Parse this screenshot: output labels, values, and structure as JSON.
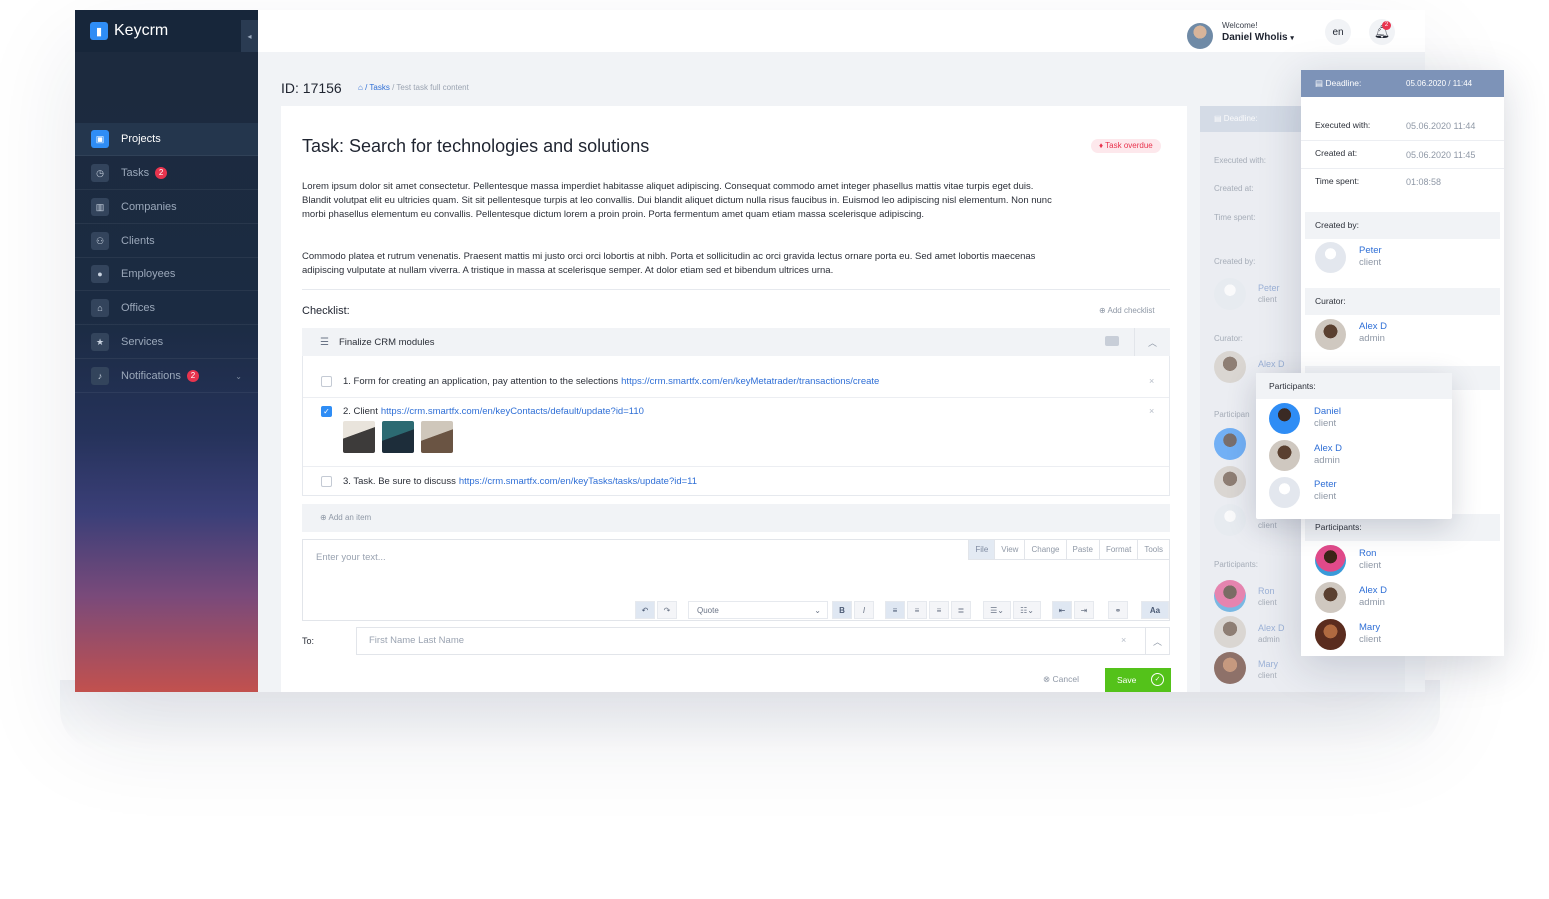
{
  "app": {
    "name": "Keycrm"
  },
  "header": {
    "welcome": "Welcome!",
    "username": "Daniel Wholis",
    "lang": "en",
    "notification_count": "2"
  },
  "sidebar": {
    "items": [
      {
        "label": "Projects",
        "icon": "briefcase-icon",
        "active": true
      },
      {
        "label": "Tasks",
        "icon": "clock-icon",
        "badge": "2"
      },
      {
        "label": "Companies",
        "icon": "building-icon"
      },
      {
        "label": "Clients",
        "icon": "users-icon"
      },
      {
        "label": "Employees",
        "icon": "user-icon"
      },
      {
        "label": "Offices",
        "icon": "bank-icon"
      },
      {
        "label": "Services",
        "icon": "star-icon"
      },
      {
        "label": "Notifications",
        "icon": "bell-icon",
        "badge": "2"
      }
    ]
  },
  "page": {
    "id_label": "ID: 17156",
    "breadcrumb": {
      "tasks": "/ Tasks",
      "sep": "/",
      "current": "Test task full content"
    }
  },
  "task": {
    "title": "Task: Search for technologies and solutions",
    "status": "Task overdue",
    "paragraph1": "Lorem ipsum dolor sit amet consectetur. Pellentesque massa imperdiet habitasse aliquet adipiscing. Consequat commodo amet integer phasellus mattis vitae turpis eget duis. Blandit volutpat elit eu ultricies quam. Sit sit pellentesque turpis at leo convallis. Dui blandit aliquet dictum nulla risus faucibus in. Euismod leo adipiscing nisl elementum. Non nunc morbi phasellus elementum eu convallis. Pellentesque dictum lorem a proin proin. Porta fermentum amet quam etiam massa scelerisque adipiscing.",
    "paragraph2": "Commodo platea et rutrum venenatis. Praesent mattis mi justo orci orci lobortis at nibh. Porta et sollicitudin ac orci gravida lectus ornare porta eu. Sed amet lobortis maecenas adipiscing vulputate at nullam viverra. A tristique in massa at scelerisque semper. At dolor etiam sed et bibendum ultrices urna."
  },
  "checklist": {
    "heading": "Checklist:",
    "add_label": "Add checklist",
    "group_title": "Finalize CRM modules",
    "items": [
      {
        "text": "1. Form for creating an application, pay attention to the selections",
        "link": "https://crm.smartfx.com/en/keyMetatrader/transactions/create",
        "checked": false
      },
      {
        "text": "2. Client",
        "link": "https://crm.smartfx.com/en/keyContacts/default/update?id=110",
        "checked": true
      },
      {
        "text": "3. Task. Be sure to discuss",
        "link": "https://crm.smartfx.com/en/keyTasks/tasks/update?id=11",
        "checked": false
      }
    ],
    "add_item_label": "Add an item"
  },
  "editor": {
    "placeholder": "Enter your text...",
    "tabs": [
      "File",
      "View",
      "Change",
      "Paste",
      "Format",
      "Tools"
    ],
    "block_format": "Quote"
  },
  "recipient": {
    "label": "To:",
    "placeholder": "First Name Last Name"
  },
  "actions": {
    "cancel": "Cancel",
    "save": "Save"
  },
  "side_panel": {
    "deadline_label": "Deadline:",
    "executed_label": "Executed with:",
    "created_label": "Created at:",
    "time_label": "Time spent:",
    "created_by_label": "Created by:",
    "creator": {
      "name": "Peter",
      "role": "client"
    },
    "curator_label": "Curator:",
    "curator": {
      "name": "Alex D"
    },
    "participants_label": "Participan",
    "participants2_label": "Participants:",
    "participants": [
      {
        "name": "Ron",
        "role": "client"
      },
      {
        "name": "Alex D",
        "role": "admin"
      },
      {
        "name": "Mary",
        "role": "client"
      }
    ],
    "hidden_role": "client"
  },
  "deadline_popup": {
    "deadline_label": "Deadline:",
    "deadline_value": "05.06.2020  /  11:44",
    "executed_label": "Executed with:",
    "executed_value": "05.06.2020 11:44",
    "created_label": "Created at:",
    "created_value": "05.06.2020 11:45",
    "time_label": "Time spent:",
    "time_value": "01:08:58",
    "created_by_label": "Created by:",
    "creator": {
      "name": "Peter",
      "role": "client"
    },
    "curator_label": "Curator:",
    "curator": {
      "name": "Alex D",
      "role": "admin"
    },
    "participants_label": "Participants:",
    "participants": [
      {
        "name": "Ron",
        "role": "client"
      },
      {
        "name": "Alex D",
        "role": "admin"
      },
      {
        "name": "Mary",
        "role": "client"
      }
    ]
  },
  "participants_dropdown": {
    "label": "Participants:",
    "people": [
      {
        "name": "Daniel",
        "role": "client"
      },
      {
        "name": "Alex D",
        "role": "admin"
      },
      {
        "name": "Peter",
        "role": "client"
      }
    ]
  },
  "colors": {
    "accent": "#2f8df5",
    "danger": "#e8344e",
    "success": "#54c21a",
    "sidebar": "#1c2a3d"
  }
}
